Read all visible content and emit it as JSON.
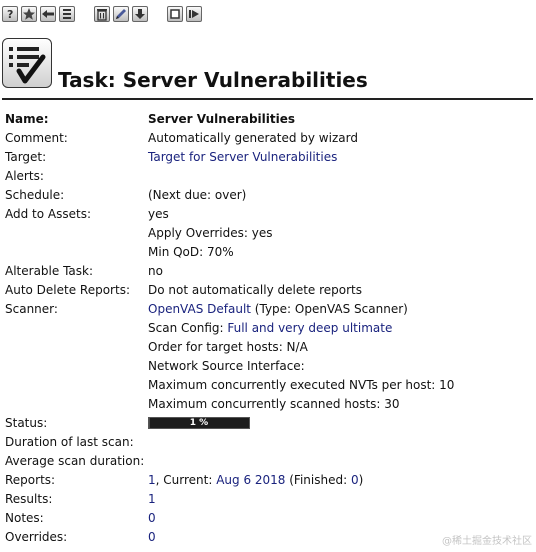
{
  "page": {
    "title": "Task: Server Vulnerabilities"
  },
  "toolbar": {
    "buttons": [
      {
        "name": "help-icon"
      },
      {
        "name": "new-task-icon"
      },
      {
        "name": "back-to-list-icon"
      },
      {
        "name": "task-list-icon"
      },
      {
        "name": "delete-icon"
      },
      {
        "name": "edit-icon"
      },
      {
        "name": "download-icon"
      },
      {
        "name": "stop-icon"
      },
      {
        "name": "resume-icon"
      }
    ]
  },
  "details": {
    "name_label": "Name:",
    "name_value": "Server Vulnerabilities",
    "comment_label": "Comment:",
    "comment_value": "Automatically generated by wizard",
    "target_label": "Target:",
    "target_value": "Target for Server Vulnerabilities",
    "alerts_label": "Alerts:",
    "schedule_label": "Schedule:",
    "schedule_value": "(Next due: over)",
    "add_to_assets_label": "Add to Assets:",
    "add_to_assets_value": "yes",
    "apply_overrides": "Apply Overrides: yes",
    "min_qod": "Min QoD: 70%",
    "alterable_label": "Alterable Task:",
    "alterable_value": "no",
    "auto_delete_label": "Auto Delete Reports:",
    "auto_delete_value": "Do not automatically delete reports",
    "scanner_label": "Scanner:",
    "scanner_name": "OpenVAS Default",
    "scanner_type": " (Type: OpenVAS Scanner)",
    "scan_config_prefix": "Scan Config: ",
    "scan_config_value": "Full and very deep ultimate",
    "order_hosts": "Order for target hosts: N/A",
    "network_source": "Network Source Interface:",
    "max_nvts": "Maximum concurrently executed NVTs per host: 10",
    "max_hosts": "Maximum concurrently scanned hosts: 30",
    "status_label": "Status:",
    "status_progress_text": "1 %",
    "status_progress_fraction": 0.01,
    "duration_label": "Duration of last scan:",
    "avg_duration_label": "Average scan duration:",
    "reports_label": "Reports:",
    "reports_count": "1",
    "reports_current_prefix": ", Current: ",
    "reports_current_date": "Aug 6 2018",
    "reports_finished_prefix": " (Finished: ",
    "reports_finished_count": "0",
    "reports_finished_suffix": ")",
    "results_label": "Results:",
    "results_value": "1",
    "notes_label": "Notes:",
    "notes_value": "0",
    "overrides_label": "Overrides:",
    "overrides_value": "0"
  },
  "watermark": "@稀土掘金技术社区",
  "colors": {
    "link": "#1a237e",
    "progress_bg": "#1c1c1c",
    "rule": "#222222"
  }
}
